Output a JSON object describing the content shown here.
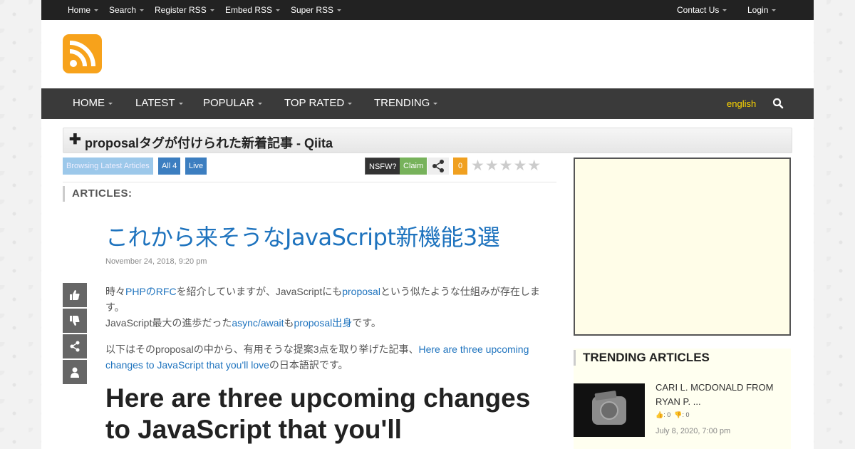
{
  "topbar": {
    "left": [
      "Home",
      "Search",
      "Register RSS",
      "Embed RSS",
      "Super RSS"
    ],
    "right": [
      "Contact Us",
      "Login"
    ]
  },
  "nav": {
    "items": [
      "HOME",
      "LATEST",
      "POPULAR",
      "TOP RATED",
      "TRENDING"
    ],
    "language": "english"
  },
  "title": "proposalタグが付けられた新着記事 - Qiita",
  "actions": {
    "browse": "Browsing Latest Articles",
    "all": "All 4",
    "live": "Live",
    "nsfw": "NSFW?",
    "claim": "Claim",
    "count": "0",
    "stars": "★★★★★",
    "rating": 0
  },
  "articles_heading": "ARTICLES:",
  "article": {
    "title": "これから来そうなJavaScript新機能3選",
    "date": "November 24, 2018, 9:20 pm",
    "p1_a": "時々",
    "p1_link1": "PHPのRFC",
    "p1_b": "を紹介していますが、JavaScriptにも",
    "p1_link2": "proposal",
    "p1_c": "という似たような仕組みが存在します。",
    "p2_a": "JavaScript最大の進歩だった",
    "p2_link1": "async/await",
    "p2_b": "も",
    "p2_link2": "proposal出身",
    "p2_c": "です。",
    "p3_a": "以下はそのproposalの中から、有用そうな提案3点を取り挙げた記事、",
    "p3_link": "Here are three upcoming changes to JavaScript that you'll love",
    "p3_b": "の日本語訳です。",
    "heading": "Here are three upcoming changes to JavaScript that you'll"
  },
  "trending": {
    "heading": "TRENDING ARTICLES",
    "item_title": "CARI L. MCDONALD FROM RYAN P. ...",
    "likes": "0",
    "dislikes": "0",
    "date": "July 8, 2020, 7:00 pm"
  },
  "colors": {
    "accent": "#1e73be",
    "logo": "#f7a21b",
    "topbar": "#222222",
    "nav": "#3a3a3a",
    "language": "#ffd700"
  }
}
